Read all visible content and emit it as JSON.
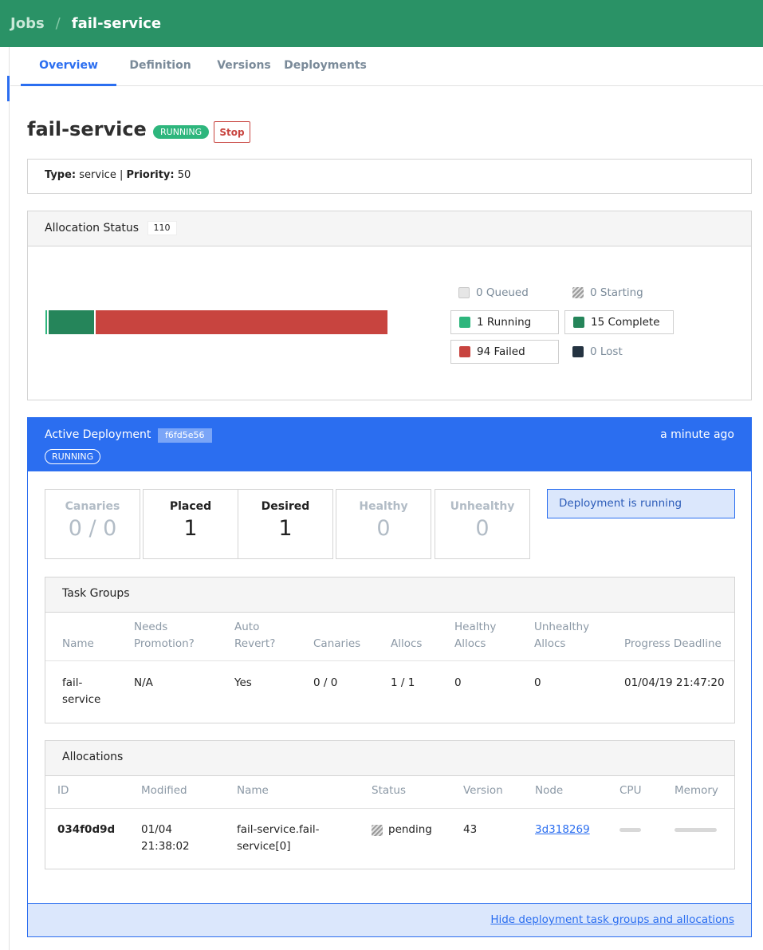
{
  "breadcrumb": {
    "root": "Jobs",
    "separator": "/",
    "current": "fail-service"
  },
  "tabs": [
    {
      "label": "Overview",
      "active": true
    },
    {
      "label": "Definition",
      "active": false
    },
    {
      "label": "Versions",
      "active": false
    },
    {
      "label": "Deployments",
      "active": false
    }
  ],
  "job": {
    "name": "fail-service",
    "status": "RUNNING",
    "stop_label": "Stop",
    "type_label": "Type:",
    "type_value": "service",
    "priority_label": "Priority:",
    "priority_value": "50",
    "divider": "|"
  },
  "allocation_status": {
    "title": "Allocation Status",
    "total": "110",
    "legend": {
      "queued": "0 Queued",
      "starting": "0 Starting",
      "running": "1 Running",
      "complete": "15 Complete",
      "failed": "94 Failed",
      "lost": "0 Lost"
    },
    "counts": {
      "queued": 0,
      "starting": 0,
      "running": 1,
      "complete": 15,
      "failed": 94,
      "lost": 0
    },
    "colors": {
      "queued": "#e0e0e0",
      "running": "#2eb67d",
      "complete": "#25855a",
      "failed": "#c8443f",
      "lost": "#243341"
    }
  },
  "deployment": {
    "title": "Active Deployment",
    "id": "f6fd5e56",
    "status": "RUNNING",
    "time": "a minute ago",
    "metrics": {
      "canaries": {
        "label": "Canaries",
        "value": "0 / 0"
      },
      "placed": {
        "label": "Placed",
        "value": "1"
      },
      "desired": {
        "label": "Desired",
        "value": "1"
      },
      "healthy": {
        "label": "Healthy",
        "value": "0"
      },
      "unhealthy": {
        "label": "Unhealthy",
        "value": "0"
      }
    },
    "notice": "Deployment is running",
    "task_groups": {
      "title": "Task Groups",
      "headers": {
        "name": "Name",
        "needs_promotion_1": "Needs",
        "needs_promotion_2": "Promotion?",
        "auto_revert_1": "Auto",
        "auto_revert_2": "Revert?",
        "canaries": "Canaries",
        "allocs": "Allocs",
        "healthy_1": "Healthy",
        "healthy_2": "Allocs",
        "unhealthy_1": "Unhealthy",
        "unhealthy_2": "Allocs",
        "progress_deadline": "Progress Deadline"
      },
      "row": {
        "name_1": "fail-",
        "name_2": "service",
        "needs_promotion": "N/A",
        "auto_revert": "Yes",
        "canaries": "0 / 0",
        "allocs": "1 / 1",
        "healthy": "0",
        "unhealthy": "0",
        "progress_deadline": "01/04/19 21:47:20"
      }
    },
    "allocations": {
      "title": "Allocations",
      "headers": {
        "id": "ID",
        "modified": "Modified",
        "name": "Name",
        "status": "Status",
        "version": "Version",
        "node": "Node",
        "cpu": "CPU",
        "memory": "Memory"
      },
      "row": {
        "id": "034f0d9d",
        "modified_1": "01/04",
        "modified_2": "21:38:02",
        "name_1": "fail-service.fail-",
        "name_2": "service[0]",
        "status": "pending",
        "version": "43",
        "node": "3d318269"
      }
    },
    "footer_link": "Hide deployment task groups and allocations"
  },
  "colors": {
    "header_green": "#2a9266",
    "accent_blue": "#2b6ef0"
  }
}
